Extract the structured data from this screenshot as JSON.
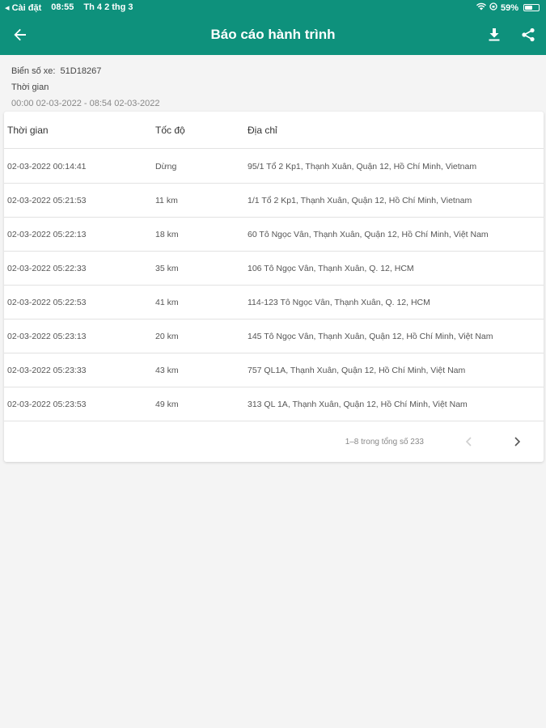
{
  "status_bar": {
    "back_app": "◂ Cài đặt",
    "time": "08:55",
    "date": "Th 4 2 thg 3",
    "battery": "59%",
    "battery_level": 0.59
  },
  "app_bar": {
    "title": "Báo cáo hành trình",
    "back_icon": "arrow-left-icon",
    "download_icon": "download-icon",
    "share_icon": "share-icon"
  },
  "info": {
    "plate_label": "Biển số xe:",
    "plate_value": "51D18267",
    "time_label": "Thời gian",
    "time_range": "00:00 02-03-2022 - 08:54 02-03-2022"
  },
  "table": {
    "headers": {
      "time": "Thời gian",
      "speed": "Tốc độ",
      "address": "Địa chỉ"
    },
    "rows": [
      {
        "time": "02-03-2022 00:14:41",
        "speed": "Dừng",
        "address": "95/1 Tổ 2 Kp1, Thạnh Xuân, Quận 12, Hồ Chí Minh, Vietnam"
      },
      {
        "time": "02-03-2022 05:21:53",
        "speed": "11 km",
        "address": "1/1 Tổ 2 Kp1, Thạnh Xuân, Quận 12, Hồ Chí Minh, Vietnam"
      },
      {
        "time": "02-03-2022 05:22:13",
        "speed": "18 km",
        "address": "60 Tô Ngọc Vân, Thạnh Xuân, Quận 12, Hồ Chí Minh, Việt Nam"
      },
      {
        "time": "02-03-2022 05:22:33",
        "speed": "35 km",
        "address": "106 Tô Ngọc Vân, Thạnh Xuân, Q. 12, HCM"
      },
      {
        "time": "02-03-2022 05:22:53",
        "speed": "41 km",
        "address": "114-123 Tô Ngọc Vân, Thạnh Xuân, Q. 12, HCM"
      },
      {
        "time": "02-03-2022 05:23:13",
        "speed": "20 km",
        "address": "145 Tô Ngọc Vân, Thạnh Xuân, Quận 12, Hồ Chí Minh, Việt Nam"
      },
      {
        "time": "02-03-2022 05:23:33",
        "speed": "43 km",
        "address": "757 QL1A, Thạnh Xuân, Quận 12, Hồ Chí Minh, Việt Nam"
      },
      {
        "time": "02-03-2022 05:23:53",
        "speed": "49 km",
        "address": "313 QL 1A, Thạnh Xuân, Quận 12, Hồ Chí Minh, Việt Nam"
      }
    ]
  },
  "pagination": {
    "range_text": "1–8 trong tổng số 233",
    "prev_icon": "chevron-left-icon",
    "next_icon": "chevron-right-icon"
  },
  "colors": {
    "primary": "#0e917c",
    "background": "#f4f4f4"
  }
}
